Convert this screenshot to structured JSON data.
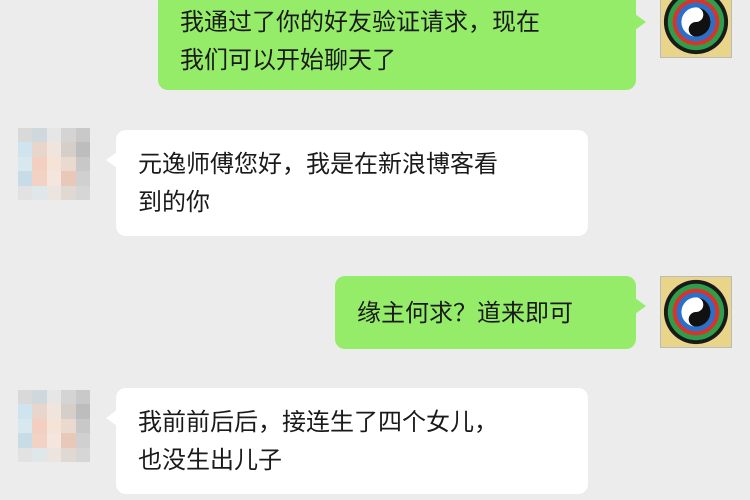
{
  "messages": [
    {
      "sender": "self",
      "text": "我通过了你的好友验证请求，现在\n我们可以开始聊天了"
    },
    {
      "sender": "other",
      "text": "元逸师傅您好，我是在新浪博客看\n到的你"
    },
    {
      "sender": "self",
      "text": "缘主何求？道来即可"
    },
    {
      "sender": "other",
      "text": "我前前后后，接连生了四个女儿，\n也没生出儿子"
    }
  ],
  "colors": {
    "background": "#ececec",
    "outgoing_bubble": "#95ec69",
    "incoming_bubble": "#ffffff"
  },
  "icons": {
    "self_avatar": "bagua-yin-yang-icon",
    "other_avatar": "pixelated-avatar-icon"
  }
}
